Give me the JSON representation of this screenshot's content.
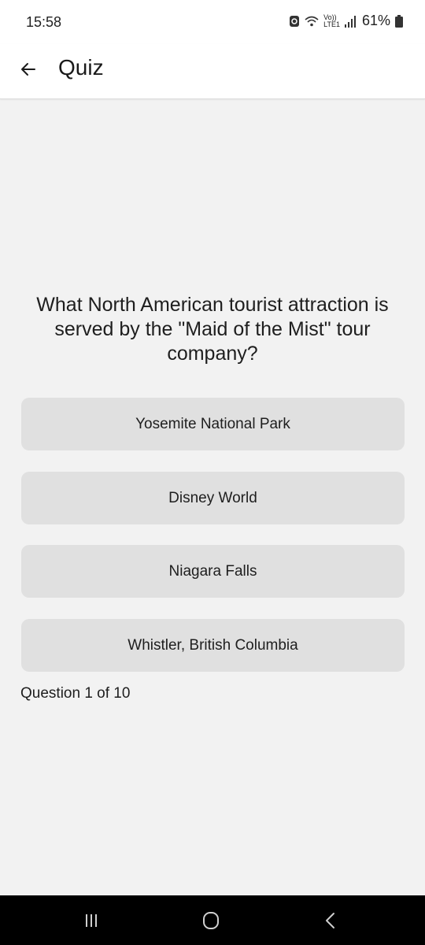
{
  "status_bar": {
    "time": "15:58",
    "network_line1": "Vo))",
    "network_line2": "LTE1",
    "battery": "61%",
    "icons": [
      "data-saver-icon",
      "wifi-icon",
      "signal-icon",
      "battery-icon"
    ]
  },
  "app_bar": {
    "title": "Quiz",
    "back_icon": "arrow-left-icon"
  },
  "quiz": {
    "question": "What North American tourist attraction is served by the \"Maid of the Mist\" tour company?",
    "answers": [
      "Yosemite National Park",
      "Disney World",
      "Niagara Falls",
      "Whistler, British Columbia"
    ],
    "progress": "Question 1 of 10"
  },
  "nav_bar": {
    "icons": [
      "recents-icon",
      "home-icon",
      "back-icon"
    ]
  },
  "colors": {
    "background": "#f2f2f2",
    "answer_button": "#e0e0e0",
    "app_bar": "#ffffff",
    "nav_bar": "#000000"
  }
}
